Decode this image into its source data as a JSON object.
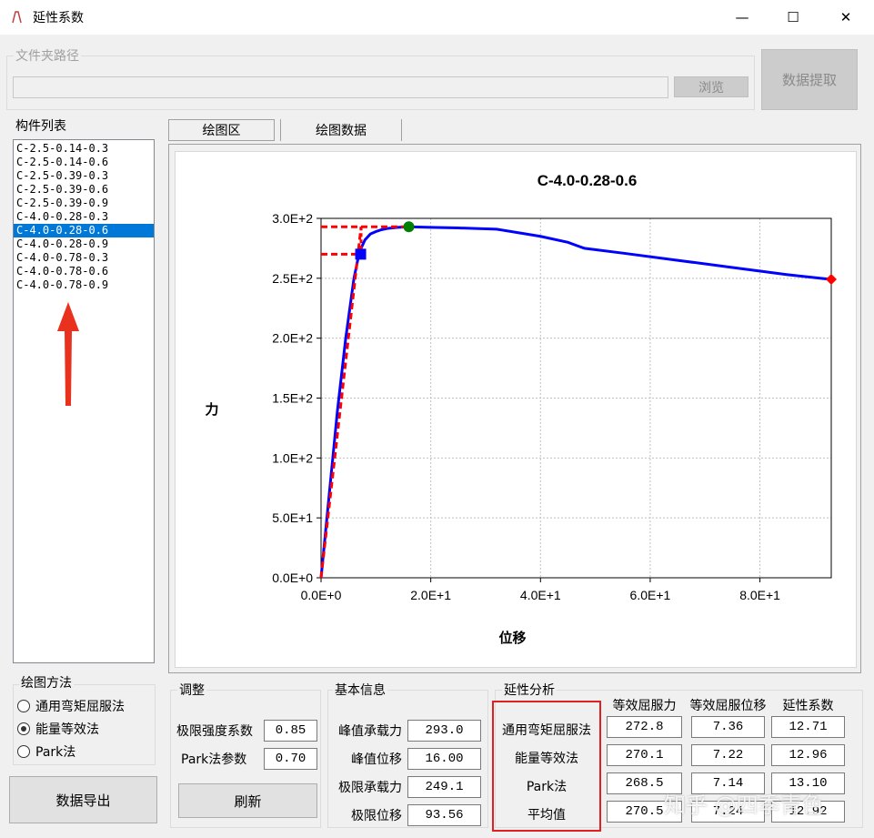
{
  "window": {
    "title": "延性系数",
    "minimize_glyph": "—",
    "maximize_glyph": "☐",
    "close_glyph": "✕"
  },
  "folder": {
    "label": "文件夹路径",
    "path_value": "",
    "browse_label": "浏览",
    "extract_label": "数据提取"
  },
  "component_list": {
    "label": "构件列表",
    "items": [
      "C-2.5-0.14-0.3",
      "C-2.5-0.14-0.6",
      "C-2.5-0.39-0.3",
      "C-2.5-0.39-0.6",
      "C-2.5-0.39-0.9",
      "C-4.0-0.28-0.3",
      "C-4.0-0.28-0.6",
      "C-4.0-0.28-0.9",
      "C-4.0-0.78-0.3",
      "C-4.0-0.78-0.6",
      "C-4.0-0.78-0.9"
    ],
    "selected_index": 6
  },
  "tabs": [
    "绘图区",
    "绘图数据"
  ],
  "plot_method": {
    "label": "绘图方法",
    "options": [
      "通用弯矩屈服法",
      "能量等效法",
      "Park法"
    ],
    "selected_index": 1
  },
  "export_label": "数据导出",
  "adjust": {
    "label": "调整",
    "ultimate_coef_label": "极限强度系数",
    "ultimate_coef_value": "0.85",
    "park_param_label": "Park法参数",
    "park_param_value": "0.70",
    "refresh_label": "刷新"
  },
  "basic_info": {
    "label": "基本信息",
    "rows": [
      {
        "label": "峰值承载力",
        "value": "293.0"
      },
      {
        "label": "峰值位移",
        "value": "16.00"
      },
      {
        "label": "极限承载力",
        "value": "249.1"
      },
      {
        "label": "极限位移",
        "value": "93.56"
      }
    ]
  },
  "ductility": {
    "label": "延性分析",
    "headers": [
      "等效屈服力",
      "等效屈服位移",
      "延性系数"
    ],
    "rows": [
      {
        "method": "通用弯矩屈服法",
        "values": [
          "272.8",
          "7.36",
          "12.71"
        ]
      },
      {
        "method": "能量等效法",
        "values": [
          "270.1",
          "7.22",
          "12.96"
        ]
      },
      {
        "method": "Park法",
        "values": [
          "268.5",
          "7.14",
          "13.10"
        ]
      },
      {
        "method": "平均值",
        "values": [
          "270.5",
          "7.24",
          "12.92"
        ]
      }
    ]
  },
  "watermark": "知乎 @四季青色",
  "colors": {
    "selection": "#0078d7",
    "curve": "#0000ff",
    "construction": "#ff0000",
    "peak_marker": "#008000",
    "highlight_box": "#e02020",
    "arrow": "#e8321e"
  },
  "chart_data": {
    "type": "line",
    "title": "C-4.0-0.28-0.6",
    "xlabel": "位移",
    "ylabel": "力",
    "xlim": [
      0,
      93
    ],
    "ylim": [
      0,
      300
    ],
    "xticks": [
      "0.0E+0",
      "2.0E+1",
      "4.0E+1",
      "6.0E+1",
      "8.0E+1"
    ],
    "yticks": [
      "0.0E+0",
      "5.0E+1",
      "1.0E+2",
      "1.5E+2",
      "2.0E+2",
      "2.5E+2",
      "3.0E+2"
    ],
    "grid": true,
    "series": [
      {
        "x": [
          0,
          1.5,
          3,
          4.5,
          6,
          7,
          8,
          9,
          10,
          11,
          12,
          13,
          14,
          16,
          20,
          25,
          32,
          40,
          45,
          48,
          55,
          65,
          75,
          85,
          93
        ],
        "y": [
          0,
          70,
          140,
          200,
          250,
          272,
          282,
          287,
          289,
          290.5,
          291.5,
          292,
          292.5,
          293,
          292.5,
          292,
          291,
          285,
          280,
          275,
          271,
          265,
          259,
          253,
          249
        ]
      }
    ],
    "construction_lines": {
      "initial_line": {
        "x": [
          0,
          7.3
        ],
        "y": [
          0,
          293
        ]
      },
      "peak_line_y": 293,
      "yield_line_y": 270.1,
      "vertical_x": 7.3
    },
    "markers": {
      "yield": {
        "x": 7.22,
        "y": 270.1
      },
      "peak": {
        "x": 16.0,
        "y": 293.0
      },
      "ultimate": {
        "x": 93.0,
        "y": 249.1
      }
    }
  }
}
